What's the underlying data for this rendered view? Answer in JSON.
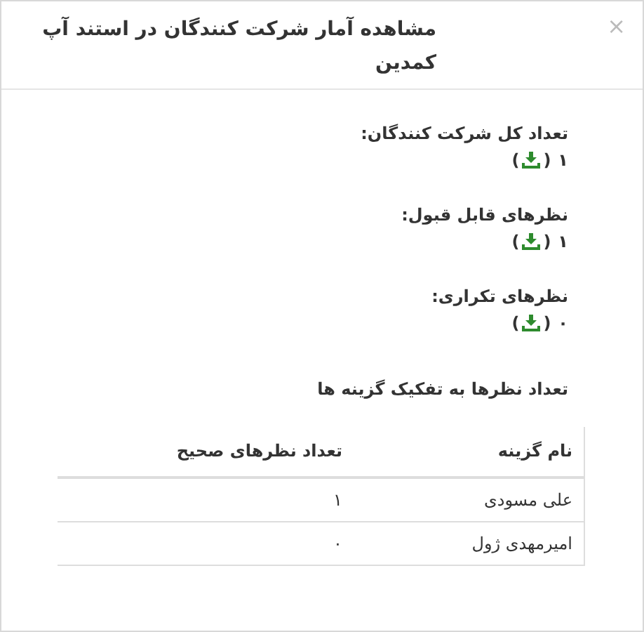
{
  "dialog": {
    "title": "مشاهده آمار شرکت کنندگان در استند آپ کمدین",
    "close": "×"
  },
  "stats": [
    {
      "label": "تعداد کل شرکت کنندگان:",
      "value": "۱",
      "open": "(",
      "close": ")"
    },
    {
      "label": "نظرهای قابل قبول:",
      "value": "۱",
      "open": "(",
      "close": ")"
    },
    {
      "label": "نظرهای تکراری:",
      "value": "۰",
      "open": "(",
      "close": ")"
    }
  ],
  "breakdown": {
    "heading": "تعداد نظرها به تفکیک گزینه ها",
    "columns": [
      "نام گزینه",
      "تعداد نظرهای صحیح"
    ],
    "rows": [
      [
        "علی مسودی",
        "۱"
      ],
      [
        "امیرمهدی ژول",
        "۰"
      ]
    ]
  }
}
